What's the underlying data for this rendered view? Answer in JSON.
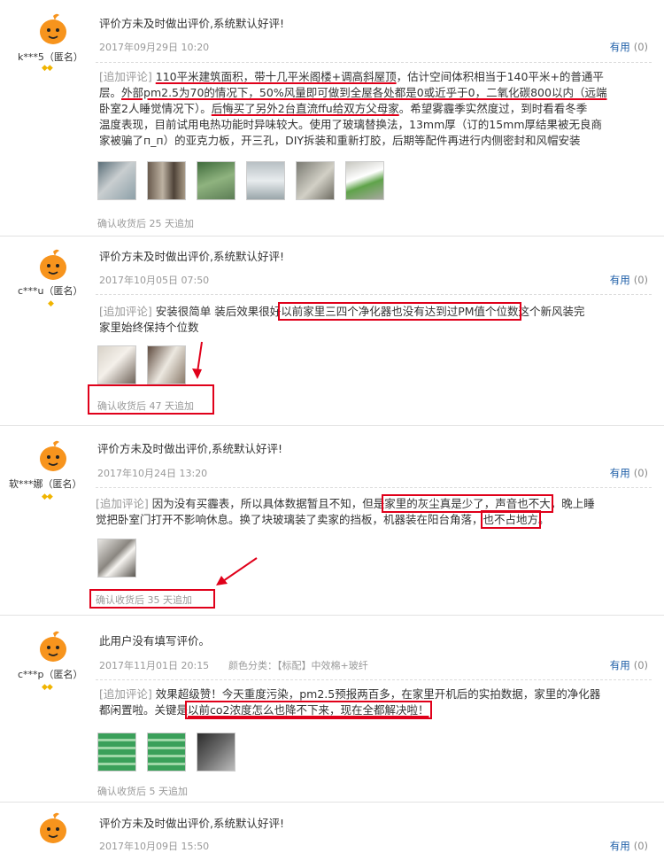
{
  "reviews": [
    {
      "user": "k***5（匿名）",
      "text": "评价方未及时做出评价,系统默认好评!",
      "date": "2017年09月29日 10:20",
      "useful_label": "有用",
      "useful_count": "(0)",
      "follow_tag": "[追加评论]",
      "follow_parts": [
        " ",
        "110平米建筑面积，带十几平米阁楼+调高斜屋顶",
        "，估计空间体积相当于140平米+的普通平",
        "层。",
        "外部pm2.5为70的情况下，50%风量即可做到全屋各处都是0或近乎于0，二氧化碳800以内（远端",
        "卧室2人睡觉情况下）。",
        "后悔买了另外2台直流ffu给双方父母家",
        "。希望雾霾季实然度过，到时看看冬季",
        "温度表现，目前试用电热功能时异味较大。使用了玻璃替换法，13mm厚（订的15mm厚结果被无良商",
        "家被骗了п_п）的亚克力板，开三孔，DIY拆装和重新打胶，后期等配件再进行内侧密封和风帽安装"
      ],
      "confirm": "确认收货后 25 天追加"
    },
    {
      "user": "c***u（匿名）",
      "text": "评价方未及时做出评价,系统默认好评!",
      "date": "2017年10月05日 07:50",
      "useful_label": "有用",
      "useful_count": "(0)",
      "follow_tag": "[追加评论]",
      "follow_parts": [
        " 安装很简单 装后效果很好",
        "以前家里三四个净化器也没有达到过PM值个位数",
        "这个新风装完",
        "家里始终保持个位数"
      ],
      "confirm": "确认收货后 47 天追加"
    },
    {
      "user": "软***娜（匿名）",
      "text": "评价方未及时做出评价,系统默认好评!",
      "date": "2017年10月24日 13:20",
      "useful_label": "有用",
      "useful_count": "(0)",
      "follow_tag": "[追加评论]",
      "follow_parts": [
        " 因为没有买霾表，所以具体数据暂且不知，但是",
        "家里的灰尘真是少了，声音也不大",
        "，晚上睡",
        "觉把卧室门打开不影响休息。换了块玻璃装了卖家的挡板，机器装在阳台角落，",
        "也不占地方",
        "。"
      ],
      "confirm": "确认收货后 35 天追加"
    },
    {
      "user": "c***p（匿名）",
      "text": "此用户没有填写评价。",
      "date": "2017年11月01日 20:15",
      "color_category": "颜色分类：【标配】中效棉+玻纤",
      "useful_label": "有用",
      "useful_count": "(0)",
      "follow_tag": "[追加评论]",
      "follow_parts": [
        " 效果超级赞！今天重度污染，pm2.5预报两百多，在家里开机后的实拍数据，家里的净化器",
        "都闲置啦。关键是",
        "以前co2浓度怎么也降不下来，现在全都解决啦！"
      ],
      "confirm": "确认收货后 5 天追加"
    },
    {
      "user": "",
      "text": "评价方未及时做出评价,系统默认好评!",
      "date": "2017年10月09日 15:50",
      "useful_label": "有用",
      "useful_count": "(0)"
    }
  ],
  "colors": {
    "highlight": "#e0001a",
    "link": "#1f5fa8",
    "avatar": "#f7941d"
  }
}
